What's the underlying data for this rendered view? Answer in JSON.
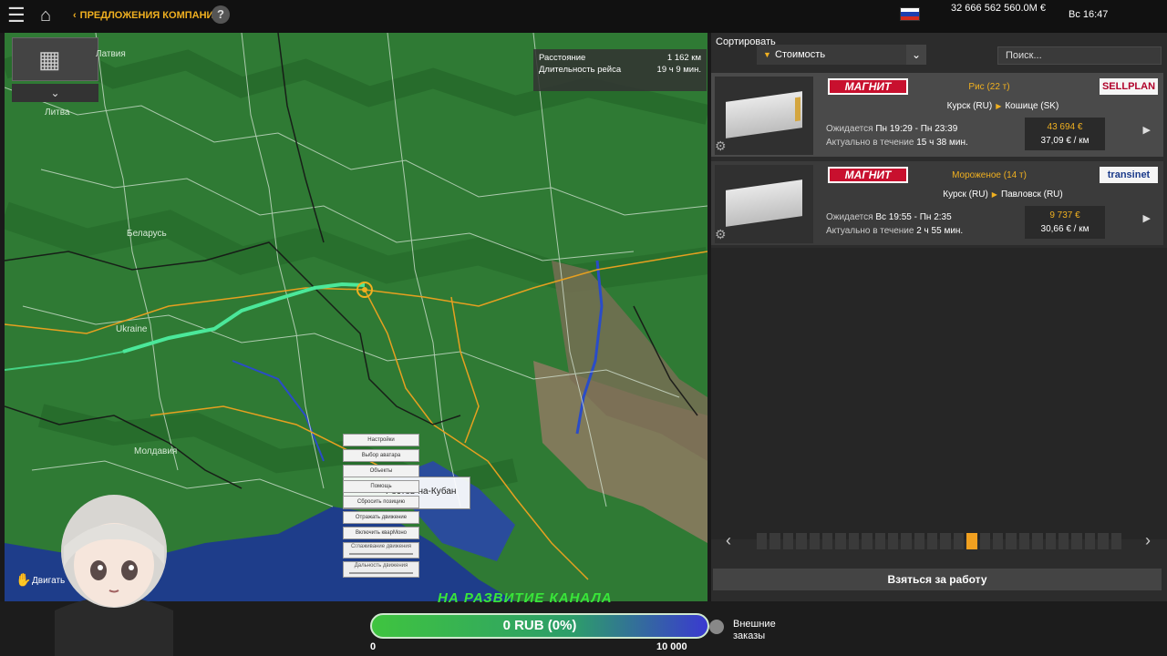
{
  "header": {
    "breadcrumb": "ПРЕДЛОЖЕНИЯ КОМПАНИЙ",
    "help": "?",
    "money": "32 666 562 560.0M €",
    "clock": "Вс 16:47"
  },
  "map": {
    "route_info": {
      "distance_label": "Расстояние",
      "distance_value": "1 162 км",
      "duration_label": "Длительность рейса",
      "duration_value": "19 ч 9 мин."
    },
    "labels": [
      "Латвия",
      "Литва",
      "Беларусь",
      "Ukraine",
      "Молдавия"
    ],
    "tooltip": "Ростов-на-Кубан",
    "context_menu": [
      "Настройки",
      "Выбор аватара",
      "Объекты",
      "Помощь",
      "Сбросить позицию",
      "Отражать движение",
      "Включить кварМоно"
    ],
    "context_sliders": [
      "Сглаживание движения",
      "Дальность движения"
    ],
    "move_hint": "Двигать"
  },
  "panel": {
    "sort_label": "Сортировать",
    "sort_value": "Стоимость",
    "search_placeholder": "Поиск...",
    "offers": [
      {
        "logo_left": "МАГНИТ",
        "cargo": "Рис (22 т)",
        "logo_right": "SELLPLAN",
        "from": "Курск (RU)",
        "to": "Кошице (SK)",
        "expected_label": "Ожидается",
        "expected_value": "Пн 19:29 - Пн 23:39",
        "valid_label": "Актуально в течение",
        "valid_value": "15 ч 38 мин.",
        "price": "43 694 €",
        "per_km": "37,09 € / км"
      },
      {
        "logo_left": "МАГНИТ",
        "cargo": "Мороженое (14 т)",
        "logo_right": "transinet",
        "from": "Курск (RU)",
        "to": "Павловск (RU)",
        "expected_label": "Ожидается",
        "expected_value": "Вс 19:55 - Пн 2:35",
        "valid_label": "Актуально в течение",
        "valid_value": "2 ч 55 мин.",
        "price": "9 737 €",
        "per_km": "30,66 € / км"
      }
    ],
    "take_job": "Взяться за работу"
  },
  "overlay": {
    "donate_label": "НА РАЗВИТИЕ КАНАЛА",
    "donate_bar": "0 RUB (0%)",
    "donate_progress": 0,
    "donate_min": "0",
    "donate_max": "10 000",
    "external_orders": "Внешние заказы"
  },
  "colors": {
    "accent": "#f0b020",
    "map_land": "#2f7a34",
    "route": "#4be89a"
  }
}
